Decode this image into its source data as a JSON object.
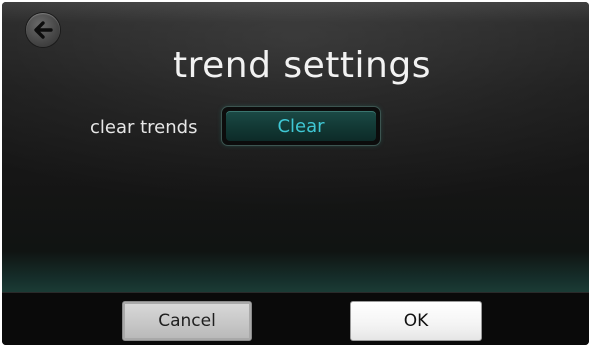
{
  "header": {
    "title": "trend settings",
    "back_icon": "back-arrow-icon"
  },
  "settings": {
    "clear_trends": {
      "label": "clear trends",
      "button_label": "Clear"
    }
  },
  "footer": {
    "cancel_label": "Cancel",
    "ok_label": "OK"
  },
  "colors": {
    "accent": "#3fc7d4",
    "screen_bg": "#1c1c1c",
    "footer_bg": "#0a0a0a"
  }
}
